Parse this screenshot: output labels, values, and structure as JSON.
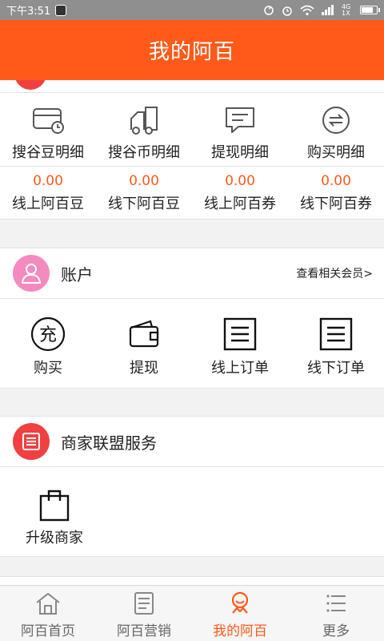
{
  "status_bar": {
    "time": "下午3:51",
    "network": "4G 1X"
  },
  "header": {
    "title": "我的阿百"
  },
  "details": [
    {
      "label": "搜谷豆明细",
      "icon": "card-clock-icon"
    },
    {
      "label": "搜谷币明细",
      "icon": "truck-icon"
    },
    {
      "label": "提现明细",
      "icon": "message-icon"
    },
    {
      "label": "购买明细",
      "icon": "exchange-icon"
    }
  ],
  "balances": [
    {
      "value": "0.00",
      "label": "线上阿百豆"
    },
    {
      "value": "0.00",
      "label": "线下阿百豆"
    },
    {
      "value": "0.00",
      "label": "线上阿百券"
    },
    {
      "value": "0.00",
      "label": "线下阿百券"
    }
  ],
  "account": {
    "title": "账户",
    "link": "查看相关会员>",
    "actions": [
      {
        "label": "购买",
        "icon": "recharge-icon",
        "glyph": "充"
      },
      {
        "label": "提现",
        "icon": "wallet-icon"
      },
      {
        "label": "线上订单",
        "icon": "order-list-icon"
      },
      {
        "label": "线下订单",
        "icon": "order-list-icon"
      }
    ]
  },
  "merchant": {
    "title": "商家联盟服务",
    "actions": [
      {
        "label": "升级商家",
        "icon": "shopping-bag-icon"
      }
    ]
  },
  "tabs": [
    {
      "label": "阿百首页",
      "icon": "home-icon",
      "active": false
    },
    {
      "label": "阿百营销",
      "icon": "marketing-icon",
      "active": false
    },
    {
      "label": "我的阿百",
      "icon": "profile-icon",
      "active": true
    },
    {
      "label": "更多",
      "icon": "more-icon",
      "active": false
    }
  ],
  "colors": {
    "accent": "#ff5a1a",
    "badge_red": "#f04040",
    "badge_pink": "#f58ac0"
  }
}
